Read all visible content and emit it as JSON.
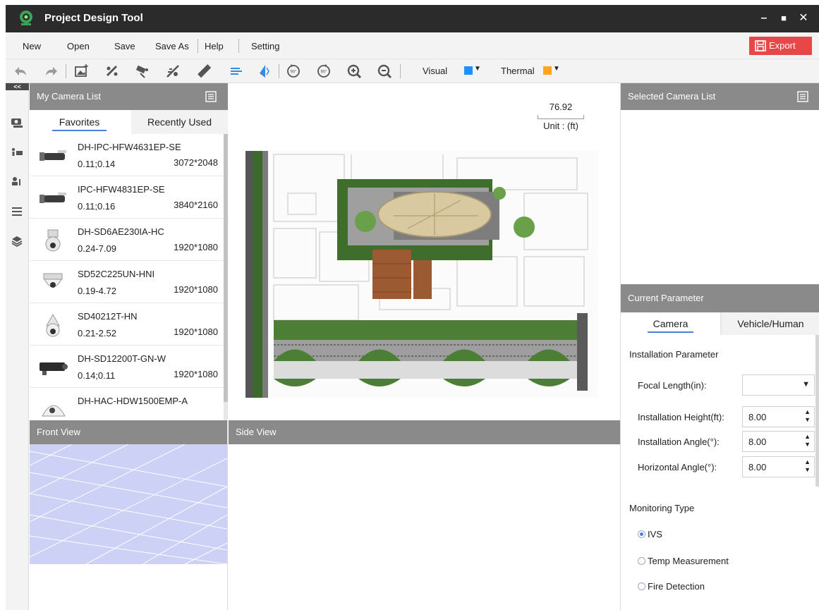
{
  "app": {
    "title": "Project Design Tool"
  },
  "window_controls": {
    "minimize": "–",
    "maximize": "■",
    "close": "✕"
  },
  "menu": {
    "new": "New",
    "open": "Open",
    "save": "Save",
    "save_as": "Save As",
    "help": "Help",
    "setting": "Setting",
    "export": "Export"
  },
  "toolbar": {
    "visual_label": "Visual",
    "thermal_label": "Thermal",
    "visual_color": "#1e90ff",
    "thermal_color": "#ffa51f"
  },
  "rail": {
    "collapse_label": "<<"
  },
  "camera_panel": {
    "title": "My Camera List",
    "tabs": [
      "Favorites",
      "Recently Used"
    ],
    "items": [
      {
        "name": "DH-IPC-HFW4631EP-SE",
        "lens": "0.11;0.14",
        "resolution": "3072*2048",
        "icon": "bullet-camera-icon"
      },
      {
        "name": "IPC-HFW4831EP-SE",
        "lens": "0.11;0.16",
        "resolution": "3840*2160",
        "icon": "bullet-camera-icon"
      },
      {
        "name": "DH-SD6AE230IA-HC",
        "lens": "0.24-7.09",
        "resolution": "1920*1080",
        "icon": "ptz-camera-icon"
      },
      {
        "name": "SD52C225UN-HNI",
        "lens": "0.19-4.72",
        "resolution": "1920*1080",
        "icon": "dome-camera-icon"
      },
      {
        "name": "SD40212T-HN",
        "lens": "0.21-2.52",
        "resolution": "1920*1080",
        "icon": "speed-dome-icon"
      },
      {
        "name": "DH-SD12200T-GN-W",
        "lens": "0.14;0.11",
        "resolution": "1920*1080",
        "icon": "box-camera-icon"
      },
      {
        "name": "DH-HAC-HDW1500EMP-A",
        "lens": "",
        "resolution": "",
        "icon": "eyeball-camera-icon"
      }
    ]
  },
  "canvas": {
    "scale_value": "76.92",
    "unit_label": "Unit : (ft)"
  },
  "views": {
    "front": "Front View",
    "side": "Side View"
  },
  "selected_panel": {
    "title": "Selected Camera List"
  },
  "parameter_panel": {
    "title": "Current Parameter",
    "tabs": [
      "Camera",
      "Vehicle/Human"
    ],
    "section_install": "Installation Parameter",
    "focal_label": "Focal Length(in):",
    "focal_value": "",
    "height_label": "Installation Height(ft):",
    "height_value": "8.00",
    "angle_label": "Installation Angle(°):",
    "angle_value": "8.00",
    "horizontal_label": "Horizontal Angle(°):",
    "horizontal_value": "8.00",
    "section_monitoring": "Monitoring Type",
    "monitoring_options": [
      "IVS",
      "Temp Measurement",
      "Fire Detection"
    ],
    "monitoring_selected": "IVS"
  }
}
